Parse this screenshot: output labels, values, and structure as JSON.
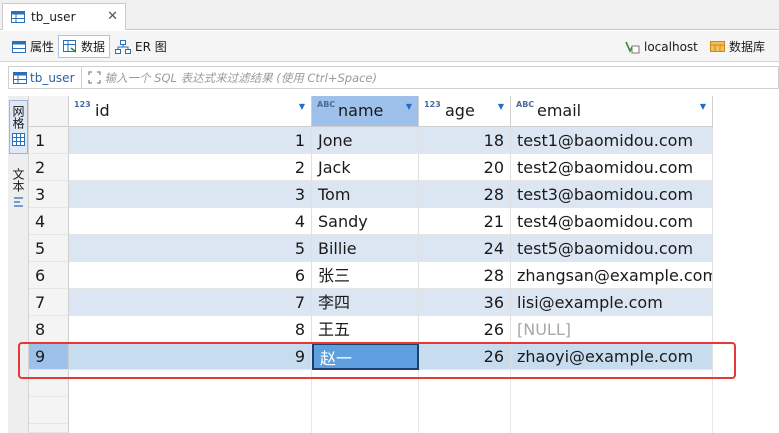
{
  "tab": {
    "title": "tb_user",
    "close": "✕"
  },
  "toolbar": {
    "properties": "属性",
    "data": "数据",
    "er": "ER 图",
    "connection": "localhost",
    "database": "数据库"
  },
  "filter": {
    "table": "tb_user",
    "placeholder": "输入一个 SQL 表达式来过滤结果 (使用 Ctrl+Space)"
  },
  "side": {
    "grid_tab": "网格",
    "text_tab": "文本"
  },
  "columns": [
    {
      "type": "123",
      "name": "id"
    },
    {
      "type": "ABC",
      "name": "name"
    },
    {
      "type": "123",
      "name": "age"
    },
    {
      "type": "ABC",
      "name": "email"
    }
  ],
  "rows": [
    {
      "num": "1",
      "id": "1",
      "name": "Jone",
      "age": "18",
      "email": "test1@baomidou.com"
    },
    {
      "num": "2",
      "id": "2",
      "name": "Jack",
      "age": "20",
      "email": "test2@baomidou.com"
    },
    {
      "num": "3",
      "id": "3",
      "name": "Tom",
      "age": "28",
      "email": "test3@baomidou.com"
    },
    {
      "num": "4",
      "id": "4",
      "name": "Sandy",
      "age": "21",
      "email": "test4@baomidou.com"
    },
    {
      "num": "5",
      "id": "5",
      "name": "Billie",
      "age": "24",
      "email": "test5@baomidou.com"
    },
    {
      "num": "6",
      "id": "6",
      "name": "张三",
      "age": "28",
      "email": "zhangsan@example.com"
    },
    {
      "num": "7",
      "id": "7",
      "name": "李四",
      "age": "36",
      "email": "lisi@example.com"
    },
    {
      "num": "8",
      "id": "8",
      "name": "王五",
      "age": "26",
      "email": "[NULL]"
    },
    {
      "num": "9",
      "id": "9",
      "name": "赵一",
      "age": "26",
      "email": "zhaoyi@example.com"
    }
  ],
  "colors": {
    "selection": "#5e9fe0",
    "highlight": "#e53935",
    "alt_row": "#dbe6f2"
  }
}
